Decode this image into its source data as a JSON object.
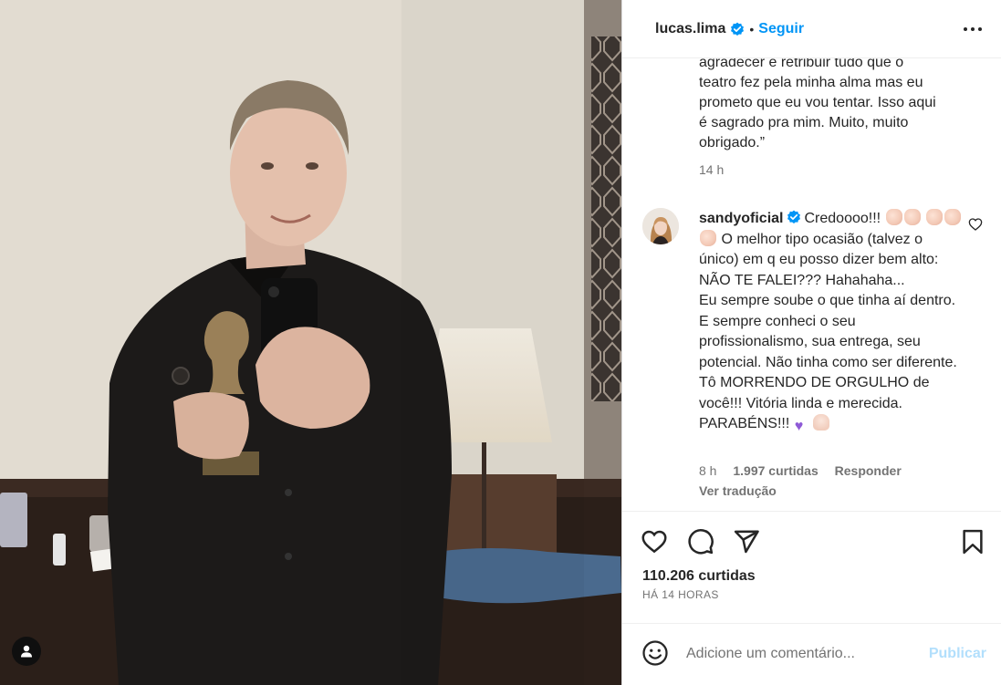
{
  "post": {
    "author": "lucas.lima",
    "separator": "•",
    "follow_label": "Seguir",
    "more_icon": "more-horizontal-icon"
  },
  "caption": {
    "lines": [
      "agradecer e retribuir tudo que o",
      "teatro fez pela minha alma mas eu",
      "prometo que eu vou tentar. Isso aqui",
      "é sagrado pra mim. Muito, muito",
      "obrigado.”"
    ],
    "time": "14 h"
  },
  "comment": {
    "username": "sandyoficial",
    "text_first": "Credoooo!!!",
    "text_rest": "O melhor tipo ocasião (talvez o único) em q eu posso dizer bem alto: NÃO TE FALEI??? Hahahaha...",
    "text_body": "Eu sempre soube o que tinha aí dentro. E sempre conheci o seu profissionalismo, sua entrega, seu potencial. Não tinha como ser diferente. Tô MORRENDO DE ORGULHO de você!!! Vitória linda e merecida. PARABÉNS!!!",
    "time": "8 h",
    "likes": "1.997 curtidas",
    "reply_label": "Responder",
    "translate_label": "Ver tradução"
  },
  "actions": {
    "likes": "110.206 curtidas",
    "time_ago": "HÁ 14 HORAS"
  },
  "add_comment": {
    "placeholder": "Adicione um comentário...",
    "publish_label": "Publicar"
  },
  "colors": {
    "accent": "#0095f6",
    "verified": "#0095f6",
    "publish_disabled": "#b2dffc",
    "muted": "#737373"
  }
}
